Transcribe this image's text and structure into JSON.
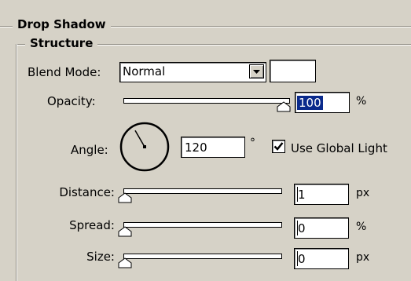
{
  "panel": {
    "title": "Drop Shadow",
    "structure_title": "Structure"
  },
  "blend": {
    "label": "Blend Mode:",
    "value": "Normal",
    "swatch_color": "#ffffff"
  },
  "opacity": {
    "label": "Opacity:",
    "value": "100",
    "unit": "%",
    "fraction": 1.0
  },
  "angle": {
    "label": "Angle:",
    "value": "120",
    "unit": "°",
    "degrees": 120
  },
  "global_light": {
    "label": "Use Global Light",
    "checked": true
  },
  "distance": {
    "label": "Distance:",
    "value": "1",
    "unit": "px",
    "fraction": 0.0
  },
  "spread": {
    "label": "Spread:",
    "value": "0",
    "unit": "%",
    "fraction": 0.0
  },
  "size": {
    "label": "Size:",
    "value": "0",
    "unit": "px",
    "fraction": 0.0
  }
}
